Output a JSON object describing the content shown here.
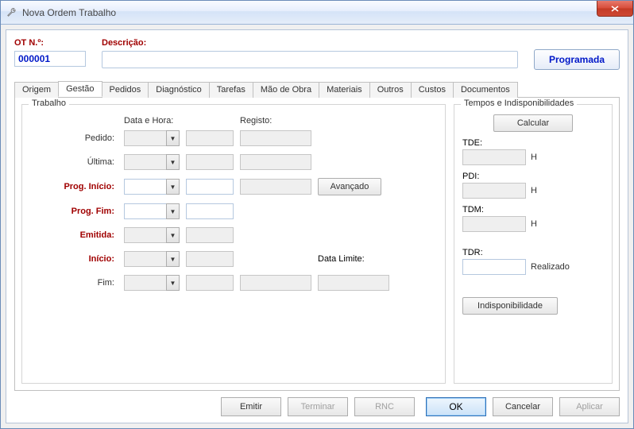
{
  "window": {
    "title": "Nova Ordem Trabalho"
  },
  "header": {
    "ot_label": "OT N.º:",
    "ot_value": "000001",
    "descr_label": "Descrição:",
    "descr_value": "",
    "prog_button": "Programada"
  },
  "tabs": {
    "origem": "Origem",
    "gestao": "Gestão",
    "pedidos": "Pedidos",
    "diagnostico": "Diagnóstico",
    "tarefas": "Tarefas",
    "mao_de_obra": "Mão de Obra",
    "materiais": "Materiais",
    "outros": "Outros",
    "custos": "Custos",
    "documentos": "Documentos"
  },
  "trabalho": {
    "legend": "Trabalho",
    "col_data_hora": "Data e Hora:",
    "col_registo": "Registo:",
    "rows": {
      "pedido": "Pedido:",
      "ultima": "Última:",
      "prog_inicio": "Prog. Início:",
      "prog_fim": "Prog. Fim:",
      "emitida": "Emitida:",
      "inicio": "Início:",
      "fim": "Fim:"
    },
    "avancado": "Avançado",
    "data_limite": "Data Limite:"
  },
  "tempos": {
    "legend": "Tempos e Indisponibilidades",
    "calcular": "Calcular",
    "tde": "TDE:",
    "pdi": "PDI:",
    "tdm": "TDM:",
    "tdr": "TDR:",
    "unit_h": "H",
    "unit_realizado": "Realizado",
    "indisp": "Indisponibilidade"
  },
  "footer": {
    "emitir": "Emitir",
    "terminar": "Terminar",
    "rnc": "RNC",
    "ok": "OK",
    "cancelar": "Cancelar",
    "aplicar": "Aplicar"
  }
}
